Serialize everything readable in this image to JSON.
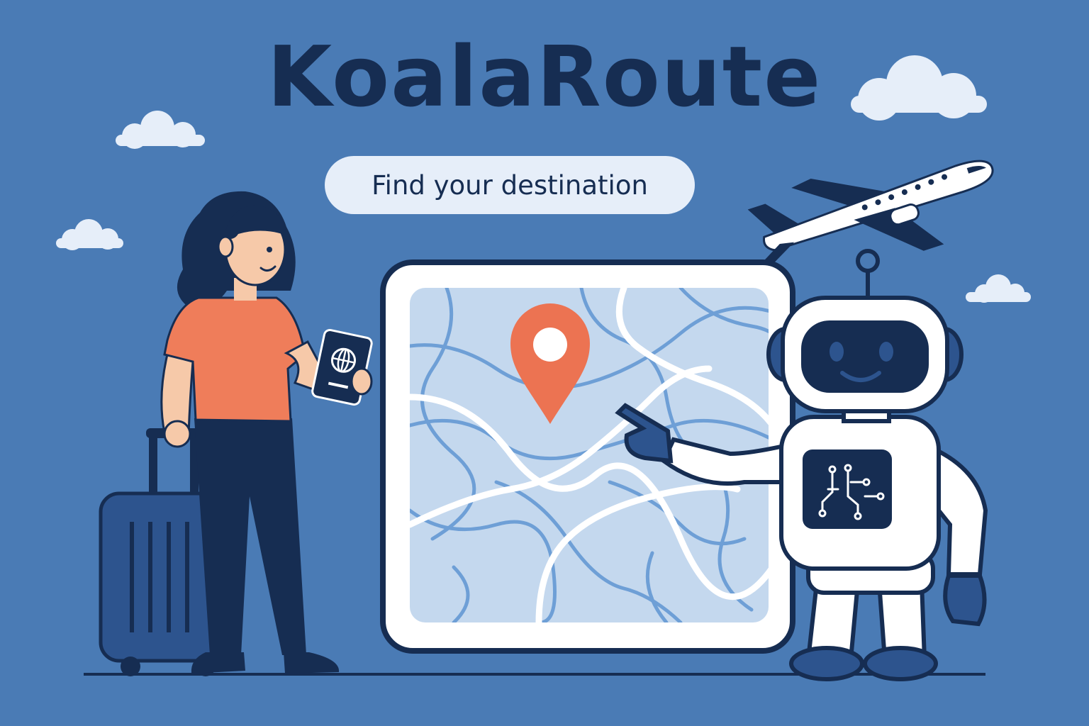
{
  "brand": {
    "title": "KoalaRoute"
  },
  "search": {
    "label": "Find your destination"
  },
  "icons": {
    "location_pin": "map-pin-icon",
    "passport_globe": "globe-icon",
    "robot_chest": "circuit-icon",
    "airplane": "airplane-icon",
    "cloud": "cloud-icon"
  },
  "colors": {
    "background": "#4a7bb5",
    "navy": "#162d52",
    "pill_background": "#e6eef9",
    "map_background": "#c4d8ee",
    "map_route_blue": "#6e9fd6",
    "pin_orange": "#ec7352",
    "shirt_orange": "#ef7d5a",
    "white": "#ffffff"
  }
}
